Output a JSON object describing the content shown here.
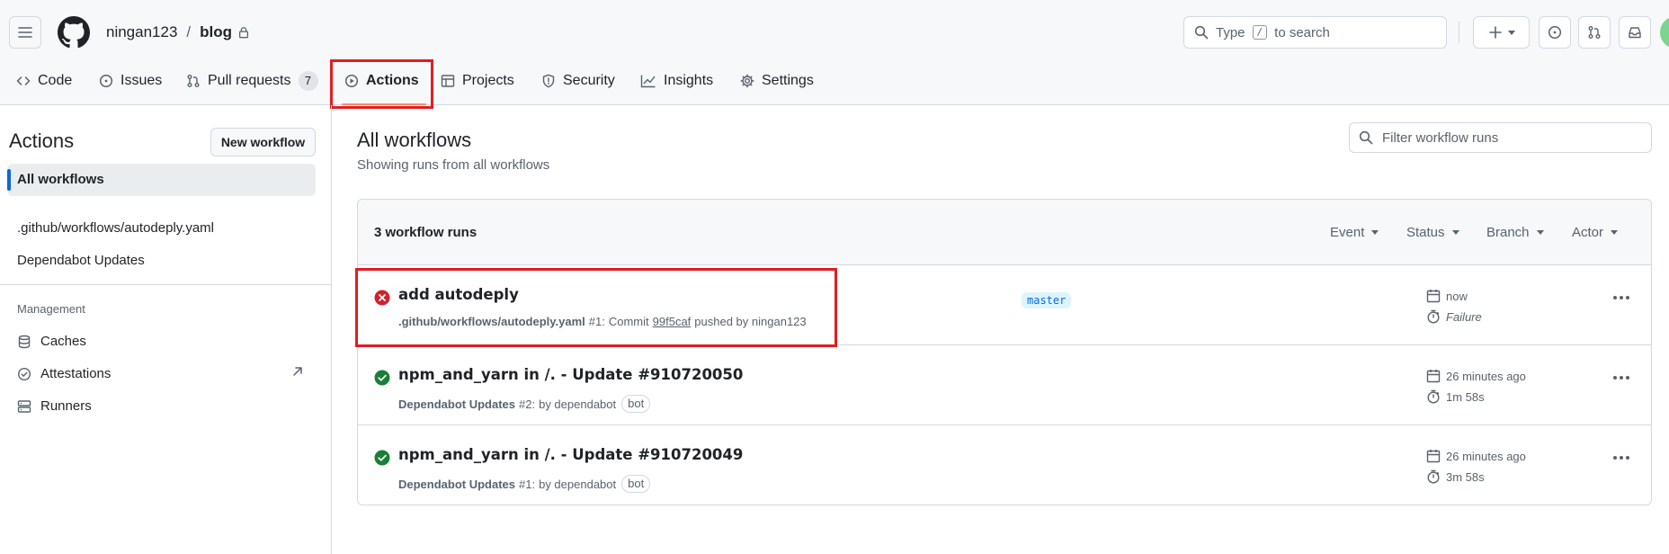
{
  "repo": {
    "owner": "ningan123",
    "separator": "/",
    "name": "blog"
  },
  "search": {
    "prefix": "Type",
    "key": "/",
    "suffix": "to search"
  },
  "tabs": [
    {
      "label": "Code",
      "icon": "code-icon"
    },
    {
      "label": "Issues",
      "icon": "issue-icon"
    },
    {
      "label": "Pull requests",
      "icon": "pull-request-icon",
      "count": "7"
    },
    {
      "label": "Actions",
      "icon": "play-icon",
      "active": true
    },
    {
      "label": "Projects",
      "icon": "table-icon"
    },
    {
      "label": "Security",
      "icon": "shield-icon"
    },
    {
      "label": "Insights",
      "icon": "graph-icon"
    },
    {
      "label": "Settings",
      "icon": "gear-icon"
    }
  ],
  "sidebar": {
    "title": "Actions",
    "new_workflow_label": "New workflow",
    "active_item": "All workflows",
    "workflows": [
      ".github/workflows/autodeply.yaml",
      "Dependabot Updates"
    ],
    "management_heading": "Management",
    "management": [
      {
        "label": "Caches",
        "icon": "database-icon"
      },
      {
        "label": "Attestations",
        "icon": "verified-icon"
      },
      {
        "label": "Runners",
        "icon": "server-icon"
      }
    ]
  },
  "main": {
    "title": "All workflows",
    "subtitle": "Showing runs from all workflows",
    "filter_placeholder": "Filter workflow runs",
    "runs_count": "3 workflow runs",
    "filters": [
      "Event",
      "Status",
      "Branch",
      "Actor"
    ]
  },
  "runs": [
    {
      "title": "add autodeply",
      "status": "failure",
      "workflow": ".github/workflows/autodeply.yaml",
      "number": "#1:",
      "commit_prefix": "Commit",
      "sha": "99f5caf",
      "pushed_by": "pushed by ningan123",
      "branch": "master",
      "time": "now",
      "duration": "Failure"
    },
    {
      "title": "npm_and_yarn in /. - Update #910720050",
      "status": "success",
      "workflow": "Dependabot Updates",
      "number": "#2:",
      "by": "by dependabot",
      "badge": "bot",
      "time": "26 minutes ago",
      "duration": "1m 58s"
    },
    {
      "title": "npm_and_yarn in /. - Update #910720049",
      "status": "success",
      "workflow": "Dependabot Updates",
      "number": "#1:",
      "by": "by dependabot",
      "badge": "bot",
      "time": "26 minutes ago",
      "duration": "3m 58s"
    }
  ],
  "colors": {
    "failure": "#cf222e",
    "success": "#1a7f37",
    "highlight": "#e11d21",
    "active_underline": "#fd8c73",
    "link_blue": "#0969da"
  }
}
